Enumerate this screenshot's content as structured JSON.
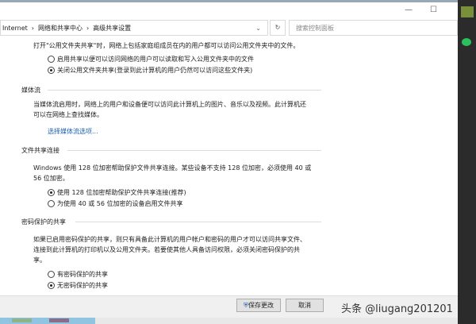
{
  "breadcrumb": [
    "Internet",
    "网络和共享中心",
    "高级共享设置"
  ],
  "search_placeholder": "搜索控制面板",
  "public": {
    "desc": "打开\"公用文件夹共享\"时，网络上包括家庭组成员在内的用户都可以访问公用文件夹中的文件。",
    "opt1": "启用共享以便可以访问网络的用户可以读取和写入公用文件夹中的文件",
    "opt2": "关闭公用文件夹共享(登录到此计算机的用户仍然可以访问这些文件夹)"
  },
  "media": {
    "title": "媒体流",
    "desc1": "当媒体流启用时，网络上的用户和设备便可以访问此计算机上的图片、音乐以及视频。此计算机还",
    "desc2": "可以在网络上查找媒体。",
    "link": "选择媒体流选项..."
  },
  "fileshare": {
    "title": "文件共享连接",
    "desc1": "Windows 使用 128 位加密帮助保护文件共享连接。某些设备不支持 128 位加密，必须使用 40 或",
    "desc2": "56 位加密。",
    "opt1": "使用 128 位加密帮助保护文件共享连接(推荐)",
    "opt2": "为使用 40 或 56 位加密的设备启用文件共享"
  },
  "password": {
    "title": "密码保护的共享",
    "desc1": "如果已启用密码保护的共享，则只有具备此计算机的用户帐户和密码的用户才可以访问共享文件、",
    "desc2": "连接到此计算机的打印机以及公用文件夹。若要使其他人具备访问权限，必须关闭密码保护的共",
    "desc3": "享。",
    "opt1": "有密码保护的共享",
    "opt2": "无密码保护的共享"
  },
  "buttons": {
    "save": "保存更改",
    "cancel": "取消"
  },
  "watermark": "头条 @liugang201201"
}
